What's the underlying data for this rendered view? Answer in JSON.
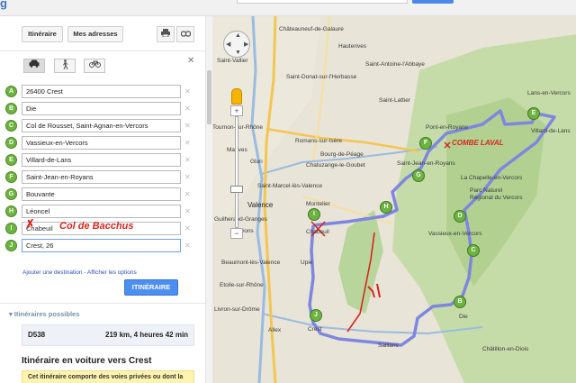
{
  "colors": {
    "accent": "#4d8ff0",
    "marker": "#6db33f",
    "route": "#7f86e0",
    "annotation": "#d8261e",
    "warning_bg": "#fff3b0",
    "map_bg": "#e8e4d8",
    "forest": "#b8d59b"
  },
  "panel": {
    "tabs": {
      "itinerary": "Itinéraire",
      "my_addresses": "Mes adresses"
    },
    "icons": {
      "print": "print-icon",
      "link": "link-icon",
      "car": "car-icon",
      "walk": "walk-icon",
      "bike": "bike-icon",
      "close": "close-icon"
    },
    "waypoints": [
      {
        "letter": "A",
        "value": "26400 Crest"
      },
      {
        "letter": "B",
        "value": "Die"
      },
      {
        "letter": "C",
        "value": "Col de Rousset, Saint-Agnan-en-Vercors"
      },
      {
        "letter": "D",
        "value": "Vassieux-en-Vercors"
      },
      {
        "letter": "E",
        "value": "Villard-de-Lans"
      },
      {
        "letter": "F",
        "value": "Saint-Jean-en-Royans"
      },
      {
        "letter": "G",
        "value": "Bouvante"
      },
      {
        "letter": "H",
        "value": "Léoncel"
      },
      {
        "letter": "I",
        "value": "Chabeuil"
      },
      {
        "letter": "J",
        "value": "Crest, 26"
      }
    ],
    "annotation": "Col de Bacchus",
    "links": "Ajouter une destination - Afficher les options",
    "itinerary_button": "ITINÉRAIRE",
    "routes_title": "Itinéraires possibles",
    "route": {
      "name": "D538",
      "stats": "219 km, 4 heures 42 min"
    },
    "drive_title": "Itinéraire en voiture vers Crest",
    "warning": "Cet itinéraire comporte des voies privées ou dont la fréquentation est limitée."
  },
  "map": {
    "towns": [
      {
        "name": "Châteauneuf-de-Galaure"
      },
      {
        "name": "Hauterives"
      },
      {
        "name": "Saint-Vallier"
      },
      {
        "name": "Saint-Antoine-l'Abbaye"
      },
      {
        "name": "Saint-Donat-sur-l'Herbasse"
      },
      {
        "name": "Saint-Lattier"
      },
      {
        "name": "Lans-en-Vercors"
      },
      {
        "name": "Tournon-sur-Rhône"
      },
      {
        "name": "Pont-en-Royans"
      },
      {
        "name": "Romans-sur-Isère"
      },
      {
        "name": "Saint-Jean-en-Royans"
      },
      {
        "name": "Mauves"
      },
      {
        "name": "Bourg-de-Péage"
      },
      {
        "name": "Glun"
      },
      {
        "name": "Chatuzange-le-Goubet"
      },
      {
        "name": "La Chapelle-en-Vercors"
      },
      {
        "name": "Saint-Marcel-lès-Valence"
      },
      {
        "name": "Parc Naturel Régional du Vercors"
      },
      {
        "name": "Valence"
      },
      {
        "name": "Montelier"
      },
      {
        "name": "Chabeuil"
      },
      {
        "name": "Guilherand-Granges"
      },
      {
        "name": "Vassieux-en-Vercors"
      },
      {
        "name": "Soyons"
      },
      {
        "name": "Upie"
      },
      {
        "name": "Beaumont-lès-Valence"
      },
      {
        "name": "Etoile-sur-Rhône"
      },
      {
        "name": "Livron-sur-Drôme"
      },
      {
        "name": "Allex"
      },
      {
        "name": "Crest"
      },
      {
        "name": "Saillans"
      },
      {
        "name": "Die"
      },
      {
        "name": "Châtillon-en-Diois"
      },
      {
        "name": "Villard-de-Lans"
      }
    ],
    "annotation": "COMBE LAVAL",
    "pins": [
      "A",
      "B",
      "C",
      "D",
      "E",
      "F",
      "G",
      "H",
      "I",
      "J"
    ],
    "controls": {
      "pan": "pan-control-icon",
      "pegman": "pegman-icon",
      "zoom_in": "+",
      "zoom_out": "−"
    }
  }
}
